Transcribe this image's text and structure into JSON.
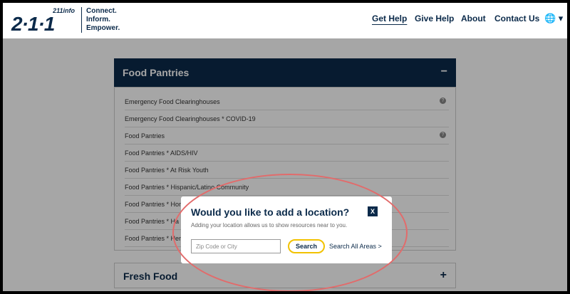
{
  "header": {
    "logo_info": "211info",
    "logo_big": "2·1·1",
    "tagline": [
      "Connect.",
      "Inform.",
      "Empower."
    ],
    "nav": [
      "Get Help",
      "Give Help",
      "About",
      "Contact Us"
    ],
    "globe": "🌐 ▾"
  },
  "accordion": {
    "title": "Food Pantries",
    "toggle": "−",
    "items": [
      {
        "label": "Emergency Food Clearinghouses",
        "help": "?"
      },
      {
        "label": "Emergency Food Clearinghouses * COVID-19"
      },
      {
        "label": "Food Pantries",
        "help": "?"
      },
      {
        "label": "Food Pantries * AIDS/HIV"
      },
      {
        "label": "Food Pantries * At Risk Youth"
      },
      {
        "label": "Food Pantries * Hispanic/Latino Community"
      },
      {
        "label": "Food Pantries * Hom"
      },
      {
        "label": "Food Pantries * Ha"
      },
      {
        "label": "Food Pantries * Hem"
      }
    ]
  },
  "fresh": {
    "title": "Fresh Food",
    "toggle": "+"
  },
  "modal": {
    "title": "Would you like to add a location?",
    "close": "X",
    "description": "Adding your location allows us to show resources near to you.",
    "input_placeholder": "Zip Code or City",
    "search_label": "Search",
    "search_all_label": "Search All Areas >"
  }
}
